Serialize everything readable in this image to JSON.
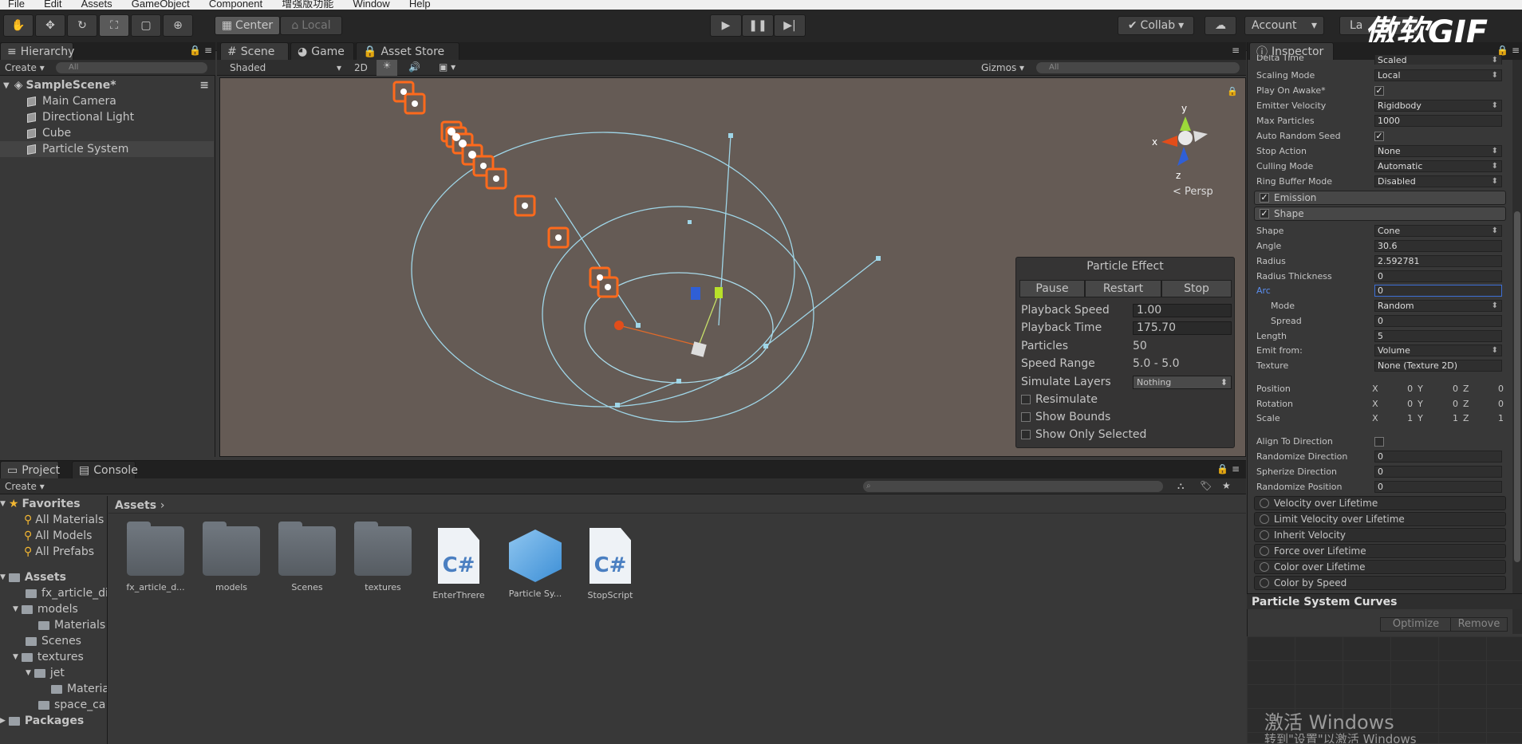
{
  "menu": {
    "file": "File",
    "edit": "Edit",
    "assets": "Assets",
    "gameobject": "GameObject",
    "component": "Component",
    "plugin": "增强版功能",
    "window": "Window",
    "help": "Help"
  },
  "toolbar": {
    "center": "Center",
    "local": "Local",
    "collab": "Collab",
    "account": "Account",
    "layers": "La",
    "watermark": "傲软GIF"
  },
  "hierarchy": {
    "tab": "Hierarchy",
    "create": "Create",
    "search_placeholder": "All",
    "scene": "SampleScene*",
    "items": [
      "Main Camera",
      "Directional Light",
      "Cube",
      "Particle System"
    ]
  },
  "scene": {
    "tabs": [
      "Scene",
      "Game",
      "Asset Store"
    ],
    "shading": "Shaded",
    "mode2d": "2D",
    "gizmos": "Gizmos",
    "search_placeholder": "All",
    "persp": "Persp",
    "axes": {
      "y": "y",
      "x": "x",
      "z": "z"
    }
  },
  "particle_effect": {
    "title": "Particle Effect",
    "pause": "Pause",
    "restart": "Restart",
    "stop": "Stop",
    "rows": [
      {
        "label": "Playback Speed",
        "value": "1.00"
      },
      {
        "label": "Playback Time",
        "value": "175.70"
      },
      {
        "label": "Particles",
        "value": "50"
      },
      {
        "label": "Speed Range",
        "value": "5.0 - 5.0"
      },
      {
        "label": "Simulate Layers",
        "value": "Nothing"
      }
    ],
    "checks": [
      "Resimulate",
      "Show Bounds",
      "Show Only Selected"
    ]
  },
  "project": {
    "tabs": [
      "Project",
      "Console"
    ],
    "create": "Create",
    "favorites": "Favorites",
    "fav_items": [
      "All Materials",
      "All Models",
      "All Prefabs"
    ],
    "assets_root": "Assets",
    "tree": [
      "fx_article_di",
      "models",
      "Materials",
      "Scenes",
      "textures",
      "jet",
      "Materia",
      "space_ca"
    ],
    "packages": "Packages",
    "breadcrumb": "Assets",
    "assets": [
      {
        "name": "fx_article_d...",
        "kind": "folder"
      },
      {
        "name": "models",
        "kind": "folder"
      },
      {
        "name": "Scenes",
        "kind": "folder"
      },
      {
        "name": "textures",
        "kind": "folder"
      },
      {
        "name": "EnterThrere",
        "kind": "script"
      },
      {
        "name": "Particle Sy...",
        "kind": "prefab"
      },
      {
        "name": "StopScript",
        "kind": "script"
      }
    ],
    "script_badge": "C#"
  },
  "inspector": {
    "tab": "Inspector",
    "main": [
      {
        "label": "Delta Time",
        "value": "Scaled",
        "drop": true
      },
      {
        "label": "Scaling Mode",
        "value": "Local",
        "drop": true
      },
      {
        "label": "Play On Awake*",
        "value": "✓",
        "check": true
      },
      {
        "label": "Emitter Velocity",
        "value": "Rigidbody",
        "drop": true
      },
      {
        "label": "Max Particles",
        "value": "1000"
      },
      {
        "label": "Auto Random Seed",
        "value": "✓",
        "check": true
      },
      {
        "label": "Stop Action",
        "value": "None",
        "drop": true
      },
      {
        "label": "Culling Mode",
        "value": "Automatic",
        "drop": true
      },
      {
        "label": "Ring Buffer Mode",
        "value": "Disabled",
        "drop": true
      }
    ],
    "emission": "Emission",
    "shape_header": "Shape",
    "shape": [
      {
        "label": "Shape",
        "value": "Cone",
        "drop": true
      },
      {
        "label": "Angle",
        "value": "30.6"
      },
      {
        "label": "Radius",
        "value": "2.592781"
      },
      {
        "label": "Radius Thickness",
        "value": "0"
      },
      {
        "label": "Arc",
        "value": "0"
      },
      {
        "label": "Mode",
        "value": "Random",
        "drop": true
      },
      {
        "label": "Spread",
        "value": "0"
      },
      {
        "label": "Length",
        "value": "5"
      },
      {
        "label": "Emit from:",
        "value": "Volume",
        "drop": true
      },
      {
        "label": "Texture",
        "value": "None (Texture 2D)"
      }
    ],
    "transform": [
      {
        "label": "Position",
        "x": "0",
        "y": "0",
        "z": "0"
      },
      {
        "label": "Rotation",
        "x": "0",
        "y": "0",
        "z": "0"
      },
      {
        "label": "Scale",
        "x": "1",
        "y": "1",
        "z": "1"
      }
    ],
    "xyz": {
      "x": "X",
      "y": "Y",
      "z": "Z"
    },
    "extra": [
      {
        "label": "Align To Direction",
        "value": ""
      },
      {
        "label": "Randomize Direction",
        "value": "0"
      },
      {
        "label": "Spherize Direction",
        "value": "0"
      },
      {
        "label": "Randomize Position",
        "value": "0"
      }
    ],
    "modules": [
      "Velocity over Lifetime",
      "Limit Velocity over Lifetime",
      "Inherit Velocity",
      "Force over Lifetime",
      "Color over Lifetime",
      "Color by Speed"
    ],
    "curves": "Particle System Curves",
    "optimize": "Optimize",
    "remove": "Remove"
  },
  "activate": {
    "line1": "激活 Windows",
    "line2": "转到\"设置\"以激活 Windows"
  }
}
